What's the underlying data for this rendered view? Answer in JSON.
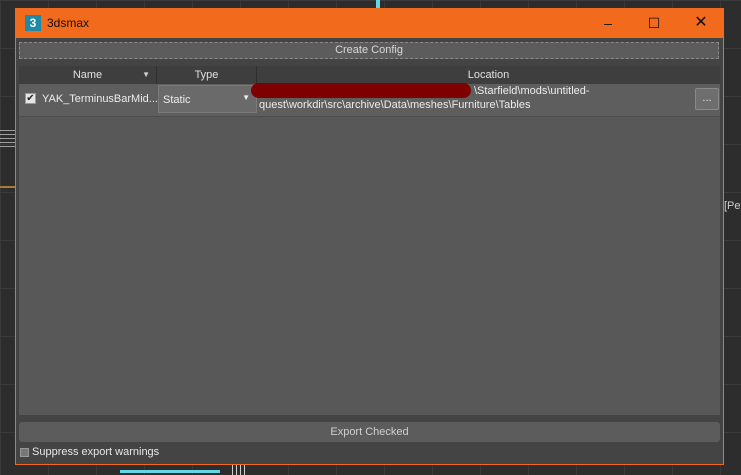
{
  "window": {
    "title": "3dsmax",
    "icon_glyph": "3",
    "minimize_glyph": "–",
    "maximize_glyph": "☐",
    "close_glyph": "✕"
  },
  "toolbar": {
    "create_config_label": "Create Config"
  },
  "table": {
    "columns": [
      "Name",
      "Type",
      "Location"
    ],
    "sort_glyph": "▼",
    "rows": [
      {
        "checked_glyph": "✔",
        "name": "YAK_TerminusBarMid...",
        "type": "Static",
        "type_arrow": "▼",
        "location_line1": "\\Starfield\\mods\\untitled-",
        "location_line2": "quest\\workdir\\src\\archive\\Data\\meshes\\Furniture\\Tables",
        "browse_label": "..."
      }
    ]
  },
  "footer": {
    "export_label": "Export Checked",
    "suppress_label": "Suppress export warnings"
  },
  "background": {
    "right_text": "[Pe"
  },
  "colors": {
    "title_bar": "#f26a1b",
    "panel": "#444444",
    "redaction": "#7e0000",
    "accent_cyan": "#5fd7e6"
  }
}
